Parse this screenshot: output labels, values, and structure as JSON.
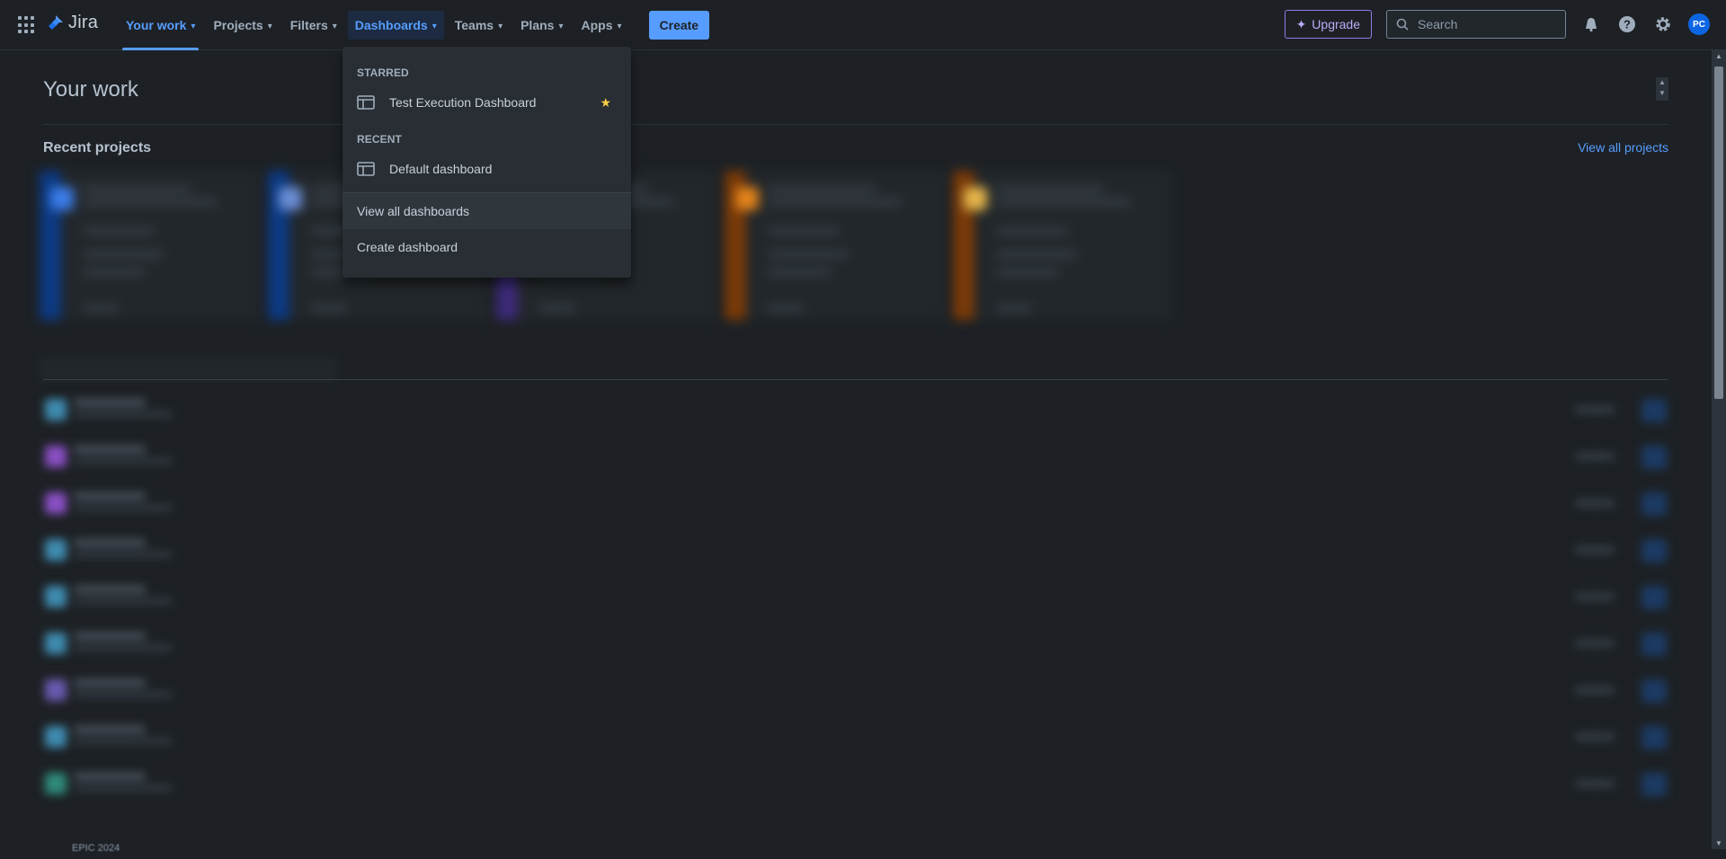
{
  "nav": {
    "logo_text": "Jira",
    "items": [
      {
        "label": "Your work"
      },
      {
        "label": "Projects"
      },
      {
        "label": "Filters"
      },
      {
        "label": "Dashboards"
      },
      {
        "label": "Teams"
      },
      {
        "label": "Plans"
      },
      {
        "label": "Apps"
      }
    ],
    "create_label": "Create",
    "upgrade_label": "Upgrade",
    "search_placeholder": "Search",
    "avatar_initials": "PC"
  },
  "main": {
    "page_title": "Your work",
    "recent_projects_title": "Recent projects",
    "view_all_projects": "View all projects",
    "epic_label": "EPIC 2024"
  },
  "dropdown": {
    "starred_heading": "STARRED",
    "starred_items": [
      {
        "label": "Test Execution Dashboard",
        "starred": true
      }
    ],
    "recent_heading": "RECENT",
    "recent_items": [
      {
        "label": "Default dashboard"
      }
    ],
    "view_all": "View all dashboards",
    "create": "Create dashboard"
  },
  "colors": {
    "accent": "#579dff",
    "background": "#1d2125",
    "star": "#f5cd47",
    "upgrade": "#8f7ee7"
  }
}
